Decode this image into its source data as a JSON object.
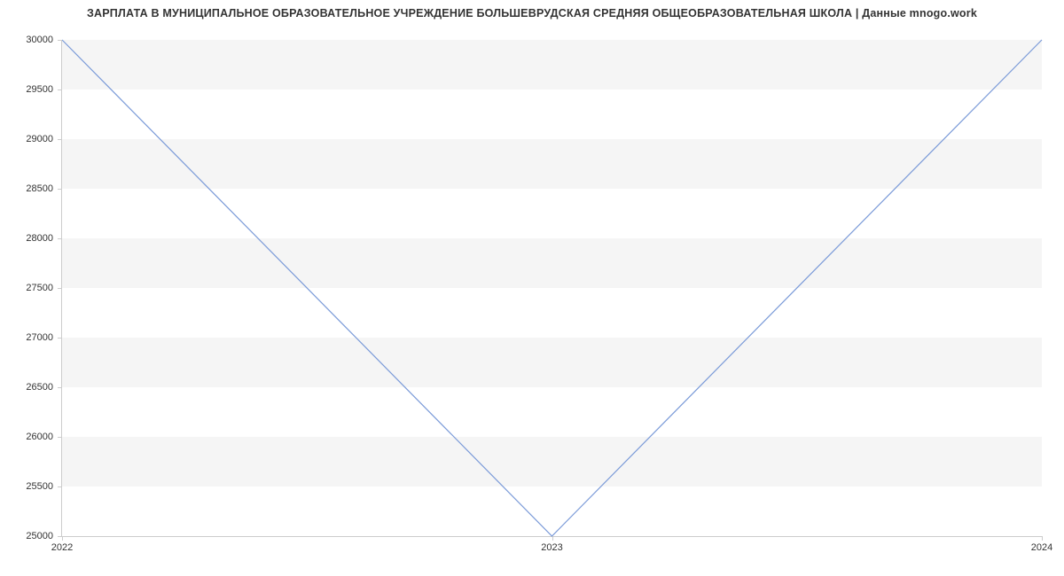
{
  "chart_data": {
    "type": "line",
    "title": "ЗАРПЛАТА В МУНИЦИПАЛЬНОЕ ОБРАЗОВАТЕЛЬНОЕ УЧРЕЖДЕНИЕ БОЛЬШЕВРУДСКАЯ СРЕДНЯЯ ОБЩЕОБРАЗОВАТЕЛЬНАЯ ШКОЛА | Данные mnogo.work",
    "x": [
      "2022",
      "2023",
      "2024"
    ],
    "values": [
      30000,
      25000,
      30000
    ],
    "xlabel": "",
    "ylabel": "",
    "ylim": [
      25000,
      30000
    ],
    "y_ticks": [
      25000,
      25500,
      26000,
      26500,
      27000,
      27500,
      28000,
      28500,
      29000,
      29500,
      30000
    ],
    "x_ticks": [
      "2022",
      "2023",
      "2024"
    ],
    "line_color": "#7a9ad8"
  }
}
